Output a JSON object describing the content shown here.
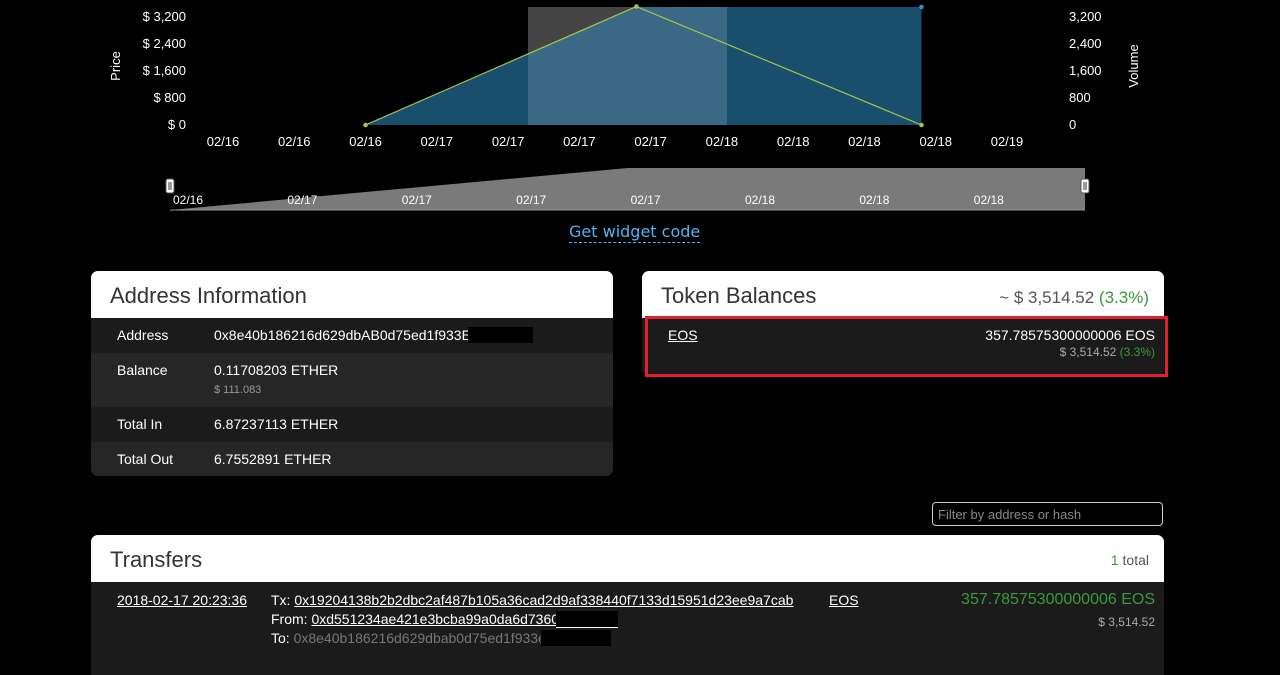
{
  "chart_data": {
    "type": "line",
    "x": [
      "02/16",
      "02/16",
      "02/16",
      "02/17",
      "02/17",
      "02/17",
      "02/17",
      "02/18",
      "02/18",
      "02/18",
      "02/18",
      "02/19"
    ],
    "price_axis": {
      "title": "Price",
      "ticks": [
        "$ 3,200",
        "$ 2,400",
        "$ 1,600",
        "$ 800",
        "$ 0"
      ],
      "ylim": [
        0,
        3500
      ]
    },
    "volume_axis": {
      "title": "Volume",
      "ticks": [
        "3,200",
        "2,400",
        "1,600",
        "800",
        "0"
      ],
      "ylim": [
        0,
        3500
      ]
    },
    "series": [
      {
        "name": "Price",
        "type": "line",
        "color": "#a6c34a",
        "points": [
          {
            "x": 2.0,
            "y": 0
          },
          {
            "x": 5.8,
            "y": 3514
          },
          {
            "x": 9.8,
            "y": 0
          }
        ]
      },
      {
        "name": "Volume",
        "type": "area",
        "color": "#1e5c80",
        "points": [
          {
            "x": 2.0,
            "y": 0
          },
          {
            "x": 5.8,
            "y": 3500
          },
          {
            "x": 9.8,
            "y": 3500
          },
          {
            "x": 9.8,
            "y": 0
          }
        ]
      }
    ],
    "navigator_ticks": [
      "02/16",
      "02/17",
      "02/17",
      "02/17",
      "02/17",
      "02/18",
      "02/18",
      "02/18"
    ]
  },
  "widget": {
    "label": "Get widget code"
  },
  "address_info": {
    "title": "Address Information",
    "rows": [
      {
        "label": "Address",
        "value": "0x8e40b186216d629dbAB0d75ed1f933EE"
      },
      {
        "label": "Balance",
        "value": "0.11708203 ETHER",
        "sub": "$ 111.083"
      },
      {
        "label": "Total In",
        "value": "6.87237113 ETHER"
      },
      {
        "label": "Total Out",
        "value": "6.7552891 ETHER"
      }
    ]
  },
  "token_balances": {
    "title": "Token Balances",
    "total_prefix": "~ $ 3,514.52",
    "total_change": "(3.3%)",
    "items": [
      {
        "name": "EOS",
        "amount": "357.78575300000006 EOS",
        "usd": "$ 3,514.52",
        "change": "(3.3%)"
      }
    ]
  },
  "filter": {
    "placeholder": "Filter by address or hash"
  },
  "transfers": {
    "title": "Transfers",
    "count": "1",
    "count_label": "total",
    "rows": [
      {
        "date": "2018-02-17 20:23:36",
        "tx_label": "Tx:",
        "tx": "0x19204138b2b2dbc2af487b105a36cad2d9af338440f7133d15951d23ee9a7cab",
        "from_label": "From:",
        "from": "0xd551234ae421e3bcba99a0da6d73607",
        "to_label": "To:",
        "to": "0x8e40b186216d629dbab0d75ed1f933ee",
        "token": "EOS",
        "amount": "357.78575300000006 EOS",
        "usd": "$ 3,514.52"
      }
    ]
  },
  "colors": {
    "accent_link": "#4fb3f6",
    "positive": "#3a9a3a",
    "highlight": "#e0202a"
  }
}
